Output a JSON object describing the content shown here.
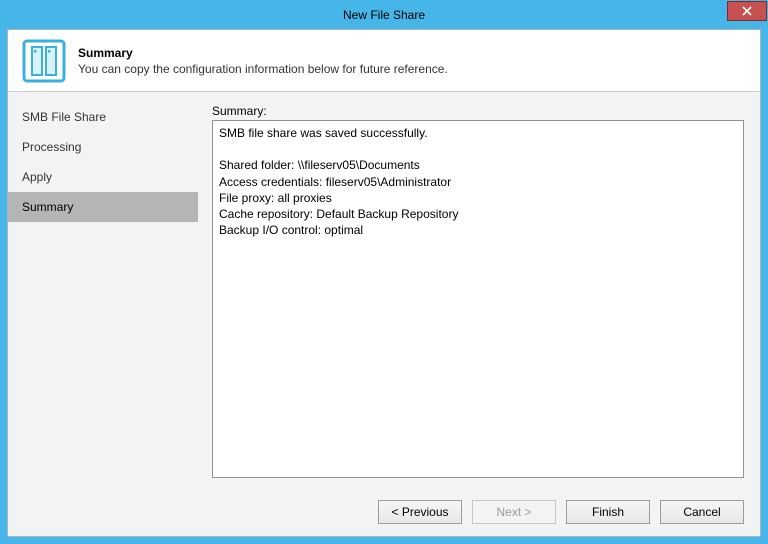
{
  "window": {
    "title": "New File Share"
  },
  "header": {
    "title": "Summary",
    "subtitle": "You can copy the configuration information below for future reference."
  },
  "sidebar": {
    "items": [
      {
        "label": "SMB File Share",
        "active": false
      },
      {
        "label": "Processing",
        "active": false
      },
      {
        "label": "Apply",
        "active": false
      },
      {
        "label": "Summary",
        "active": true
      }
    ]
  },
  "content": {
    "summary_label": "Summary:",
    "summary_text": "SMB file share was saved successfully.\n\nShared folder: \\\\fileserv05\\Documents\nAccess credentials: fileserv05\\Administrator\nFile proxy: all proxies\nCache repository: Default Backup Repository\nBackup I/O control: optimal"
  },
  "footer": {
    "previous": "< Previous",
    "next": "Next >",
    "finish": "Finish",
    "cancel": "Cancel"
  },
  "colors": {
    "accent": "#45b6e7",
    "close": "#c75050"
  }
}
